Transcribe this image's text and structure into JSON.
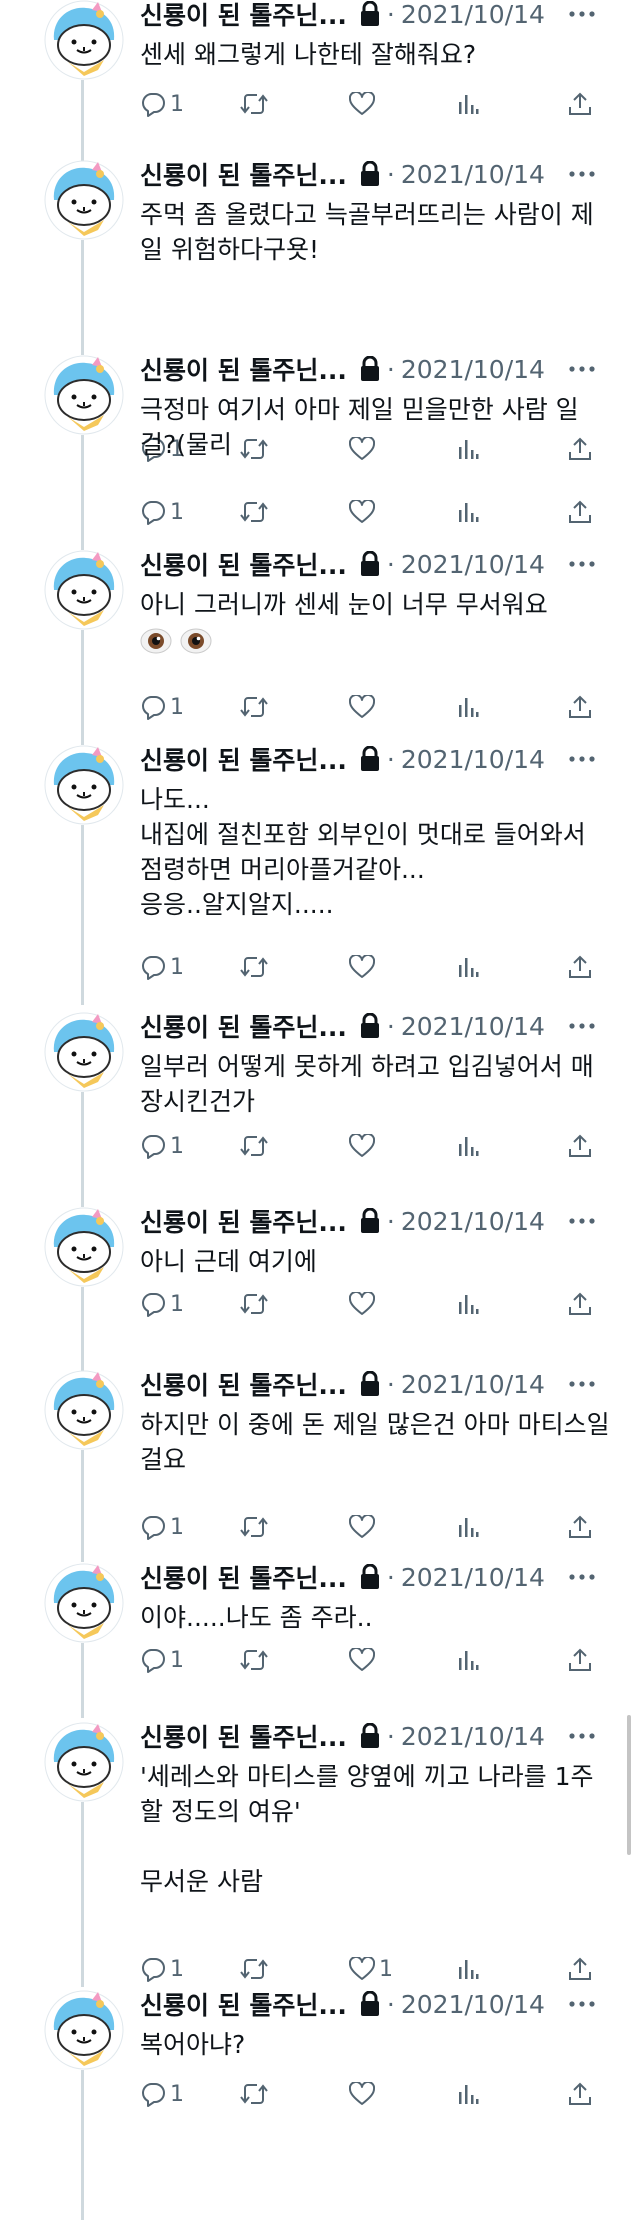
{
  "author": {
    "display_name": "신룡이 된 톨주닌...",
    "avatar_icon": "cartoon-bird-avatar",
    "protected_icon": "lock-icon"
  },
  "colors": {
    "text_primary": "#0f1419",
    "text_secondary": "#536471",
    "thread_line": "#cfd9de",
    "avatar_blue": "#6cc4ee",
    "scarf_yellow": "#f5c85a"
  },
  "tweets": [
    {
      "date": "2021/10/14",
      "text": "센세 왜그렇게 나한테 잘해줘요?",
      "reply_count": "1",
      "like_count": ""
    },
    {
      "date": "2021/10/14",
      "text": "주먹 좀 올렸다고 늑골부러뜨리는 사람이 제일 위험하다구욧!",
      "reply_count": "1",
      "like_count": ""
    },
    {
      "date": "2021/10/14",
      "text": "극정마 여기서 아마 제일 믿을만한 사람 일걸?(물리",
      "reply_count": "1",
      "like_count": ""
    },
    {
      "date": "2021/10/14",
      "text": "아니 그러니까 센세 눈이 너무 무서워요",
      "emoji": "eyes-emoji",
      "reply_count": "1",
      "like_count": ""
    },
    {
      "date": "2021/10/14",
      "text": "나도...\n내집에 절친포함 외부인이 멋대로 들어와서 점령하면 머리아플거같아...\n응응..알지알지.....",
      "reply_count": "1",
      "like_count": ""
    },
    {
      "date": "2021/10/14",
      "text": "일부러 어떻게 못하게 하려고 입김넣어서 매장시킨건가",
      "reply_count": "1",
      "like_count": ""
    },
    {
      "date": "2021/10/14",
      "text": "아니 근데 여기에",
      "reply_count": "1",
      "like_count": ""
    },
    {
      "date": "2021/10/14",
      "text": "하지만 이 중에 돈 제일 많은건 아마 마티스일걸요",
      "reply_count": "1",
      "like_count": ""
    },
    {
      "date": "2021/10/14",
      "text": "이야.....나도 좀 주라..",
      "reply_count": "1",
      "like_count": ""
    },
    {
      "date": "2021/10/14",
      "text": "'세레스와 마티스를 양옆에 끼고 나라를 1주할 정도의 여유'\n\n무서운 사람",
      "reply_count": "1",
      "like_count": "1"
    },
    {
      "date": "2021/10/14",
      "text": "복어아냐?",
      "reply_count": "1",
      "like_count": ""
    }
  ]
}
